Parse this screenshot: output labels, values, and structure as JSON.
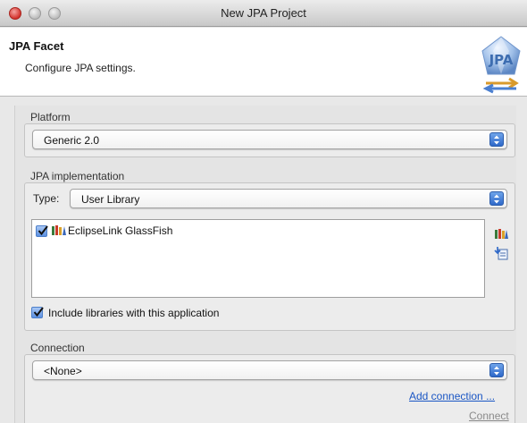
{
  "window": {
    "title": "New JPA Project"
  },
  "header": {
    "title": "JPA Facet",
    "description": "Configure JPA settings.",
    "logo_text": "JPA"
  },
  "platform": {
    "label": "Platform",
    "selected": "Generic 2.0"
  },
  "implementation": {
    "label": "JPA implementation",
    "type_label": "Type:",
    "type_selected": "User Library",
    "libraries": [
      {
        "name": "EclipseLink GlassFish",
        "checked": true
      }
    ],
    "include_label": "Include libraries with this application",
    "include_checked": true
  },
  "connection": {
    "label": "Connection",
    "selected": "<None>",
    "add_link": "Add connection ...",
    "connect_link": "Connect"
  },
  "colors": {
    "accent": "#2f69c9",
    "link": "#1a56c4",
    "disabled": "#8a8a8a"
  }
}
